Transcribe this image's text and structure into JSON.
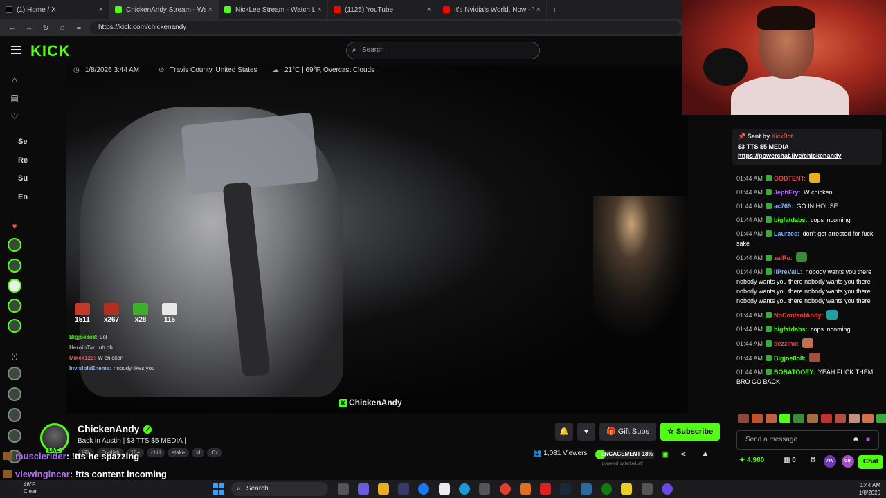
{
  "browser": {
    "tabs": [
      {
        "title": "(1) Home / X",
        "color": "#000000"
      },
      {
        "title": "ChickenAndy Stream - Watch",
        "color": "#53fc18"
      },
      {
        "title": "NickLee Stream - Watch Live o",
        "color": "#53fc18"
      },
      {
        "title": "(1125) YouTube",
        "color": "#ff0000"
      },
      {
        "title": "It's Nvidia's World, Now - YouTube",
        "color": "#ff0000"
      }
    ],
    "url": "https://kick.com/chickenandy"
  },
  "header": {
    "logo": "KICK",
    "search_placeholder": "Search"
  },
  "sidebar": {
    "labels": [
      "Se",
      "Re",
      "Su",
      "En"
    ]
  },
  "stream_info": {
    "datetime": "1/8/2026 3:44 AM",
    "location": "Travis County, United States",
    "weather": "21°C | 69°F, Overcast Clouds"
  },
  "video_stats": [
    {
      "value": "1511",
      "color": "#c23a2a"
    },
    {
      "value": "x267",
      "color": "#b03020"
    },
    {
      "value": "x28",
      "color": "#3fae2a"
    },
    {
      "value": "115",
      "color": "#e8e8e8"
    }
  ],
  "overlay_chat": [
    {
      "user": "Bigjoe8o8:",
      "text": "Lol",
      "color": "#53fc18"
    },
    {
      "user": "HeroinTar:",
      "text": "uh oh",
      "color": "#aaaaaa"
    },
    {
      "user": "Mikek123:",
      "text": "W chicken",
      "color": "#ff6a6a"
    },
    {
      "user": "InvisibleEnema:",
      "text": "nobody likes you",
      "color": "#a0c0ff"
    }
  ],
  "watermark": "ChickenAndy",
  "channel": {
    "name": "ChickenAndy",
    "title": "Back in Austin | $3 TTS $5 MEDIA |",
    "tags": [
      "IRL",
      "English",
      "18+",
      "chill",
      "stake",
      "irl",
      "Cx"
    ],
    "live": "LIVE"
  },
  "actions": {
    "gift_label": "Gift Subs",
    "subscribe_label": "Subscribe"
  },
  "viewers": "1,081 Viewers",
  "engagement": {
    "label": "ENGAGEMENT 18%",
    "percent": 18
  },
  "powered": "powered by botted.wtf",
  "tts_lines": [
    {
      "user": "musclerider",
      "text": ": !tts he spazzing"
    },
    {
      "user": "viewingincar",
      "text": ": !tts content incoming"
    }
  ],
  "pinned": {
    "sent_by": "Sent by",
    "bot": "KickBot",
    "line": "$3 TTS $5 MEDIA",
    "link": "https://powerchat.live/chickenandy"
  },
  "chat": [
    {
      "ts": "01:44 AM",
      "user": "GODTENT:",
      "text": "",
      "color": "#ff3b3b",
      "emote": "#e8b020"
    },
    {
      "ts": "01:44 AM",
      "user": "JephEry:",
      "text": "W chicken",
      "color": "#b56bff"
    },
    {
      "ts": "01:44 AM",
      "user": "ac769:",
      "text": "GO IN HOUSE",
      "color": "#7fb0ff"
    },
    {
      "ts": "01:44 AM",
      "user": "bigfatdabs:",
      "text": "cops incoming",
      "color": "#53fc18"
    },
    {
      "ts": "01:44 AM",
      "user": "Laurzee:",
      "text": "don't get arrested for fuck sake",
      "color": "#7fb0ff"
    },
    {
      "ts": "01:44 AM",
      "user": "zaiRo:",
      "text": "",
      "color": "#ff3b3b",
      "emote": "#3a8a3a"
    },
    {
      "ts": "01:44 AM",
      "user": "iiPreVaiL:",
      "text": "nobody wants you there nobody wants you there nobody wants you there nobody wants you there nobody wants you there nobody wants you there nobody wants you there",
      "color": "#7fb0ff"
    },
    {
      "ts": "01:44 AM",
      "user": "NoContentAndy:",
      "text": "",
      "color": "#ff3b3b",
      "emote": "#20a0a0"
    },
    {
      "ts": "01:44 AM",
      "user": "bigfatdabs:",
      "text": "cops incoming",
      "color": "#53fc18"
    },
    {
      "ts": "01:44 AM",
      "user": "dezzino:",
      "text": "",
      "color": "#ff3b3b",
      "emote": "#c07050"
    },
    {
      "ts": "01:44 AM",
      "user": "Bigjoe8o8:",
      "text": "",
      "color": "#53fc18",
      "emote": "#a05040"
    },
    {
      "ts": "01:44 AM",
      "user": "BOBATOOEY:",
      "text": "YEAH FUCK THEM BRO GO BACK",
      "color": "#53fc18"
    }
  ],
  "send_placeholder": "Send a message",
  "chat_footer": {
    "points": "4,980",
    "zero": "0",
    "chat_label": "Chat"
  },
  "taskbar": {
    "weather_temp": "46°F",
    "weather_desc": "Clear",
    "search": "Search",
    "time": "1:44 AM",
    "date": "1/8/2026"
  },
  "colors": {
    "accent": "#53fc18",
    "bg": "#0b0b0c"
  }
}
